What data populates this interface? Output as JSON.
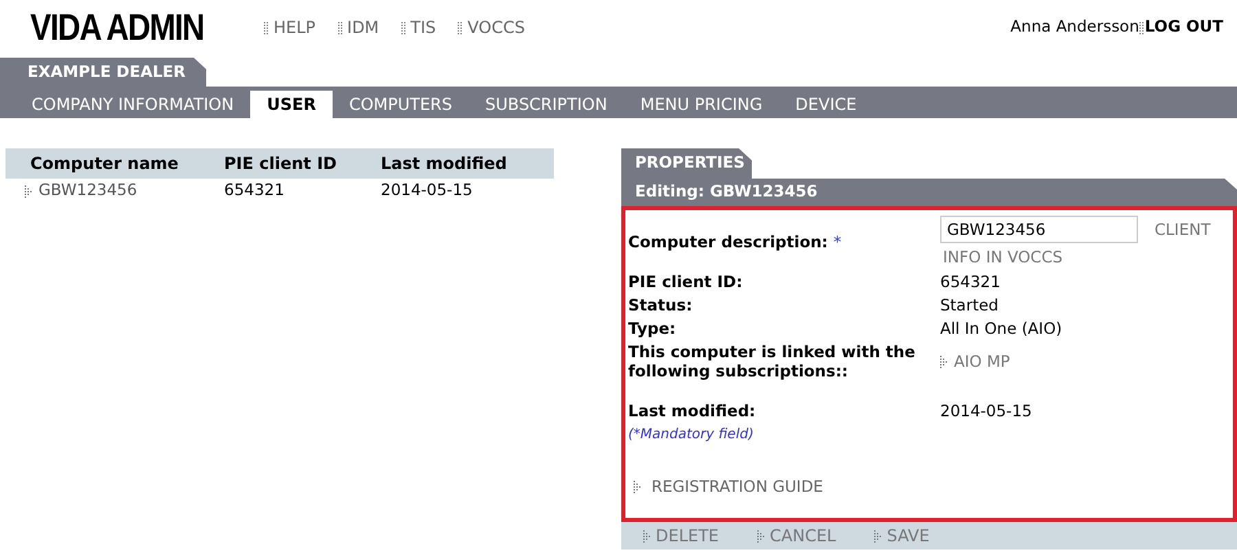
{
  "app_title": "VIDA ADMIN",
  "top_links": [
    "HELP",
    "IDM",
    "TIS",
    "VOCCS"
  ],
  "user": {
    "name": "Anna Andersson",
    "logout": "LOG OUT"
  },
  "dealer_tab": "EXAMPLE DEALER",
  "nav_tabs": [
    {
      "label": "COMPANY INFORMATION",
      "selected": false
    },
    {
      "label": "USER",
      "selected": true
    },
    {
      "label": "COMPUTERS",
      "selected": false
    },
    {
      "label": "SUBSCRIPTION",
      "selected": false
    },
    {
      "label": "MENU PRICING",
      "selected": false
    },
    {
      "label": "DEVICE",
      "selected": false
    }
  ],
  "table": {
    "columns": [
      "Computer name",
      "PIE client ID",
      "Last modified"
    ],
    "rows": [
      [
        "GBW123456",
        "654321",
        "2014-05-15"
      ]
    ]
  },
  "properties": {
    "tab": "PROPERTIES",
    "editing": "Editing: GBW123456",
    "description_label": "Computer description:",
    "required_mark": "*",
    "description_value": "GBW123456",
    "client_info_link": [
      "CLIENT",
      "INFO IN VOCCS"
    ],
    "fields": [
      {
        "label": "PIE client ID:",
        "value": "654321"
      },
      {
        "label": "Status:",
        "value": "Started"
      },
      {
        "label": "Type:",
        "value": "All In One (AIO)"
      }
    ],
    "subscriptions_label": "This computer is linked with the following subscriptions::",
    "subscriptions": [
      "AIO MP"
    ],
    "last_modified_label": "Last modified:",
    "last_modified": "2014-05-15",
    "mandatory_note": "(*Mandatory field)",
    "guide_link": "REGISTRATION GUIDE",
    "actions": [
      "DELETE",
      "CANCEL",
      "SAVE"
    ]
  }
}
